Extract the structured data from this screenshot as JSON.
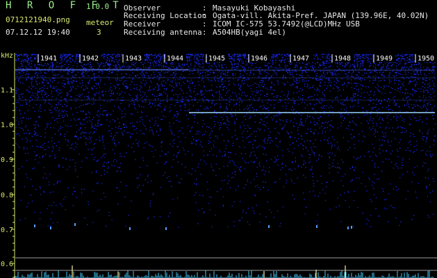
{
  "app": {
    "name": "H R O F F T",
    "version": "1.0.0"
  },
  "file": {
    "name": "0712121940.png",
    "datetime": "07.12.12 19:40"
  },
  "counter": {
    "label": "meteor",
    "value": "3"
  },
  "info": [
    {
      "key": "Observer",
      "value": "Masayuki Kobayashi"
    },
    {
      "key": "Receiving Location",
      "value": "Ogata-vill. Akita-Pref. JAPAN (139.96E, 40.02N)"
    },
    {
      "key": "Receiver",
      "value": "ICOM IC-575 53.7492(@LCD)MHz USB"
    },
    {
      "key": "Receiving antenna",
      "value": "A504HB(yagi 4el)"
    }
  ],
  "spectrogram": {
    "y_unit": "kHz",
    "y_ticks": [
      "1.1",
      "1.0",
      "0.9",
      "0.8",
      "0.7",
      "0.6"
    ],
    "time_ticks": [
      "1941",
      "1942",
      "1943",
      "1944",
      "1945",
      "1946",
      "1947",
      "1948",
      "1949",
      "1950"
    ],
    "colors": {
      "noise": "#1a2cff",
      "trace": "#9bd6ff",
      "axis": "#d9e870",
      "text": "#ffffff",
      "baseline": "#cfcfcf"
    }
  }
}
